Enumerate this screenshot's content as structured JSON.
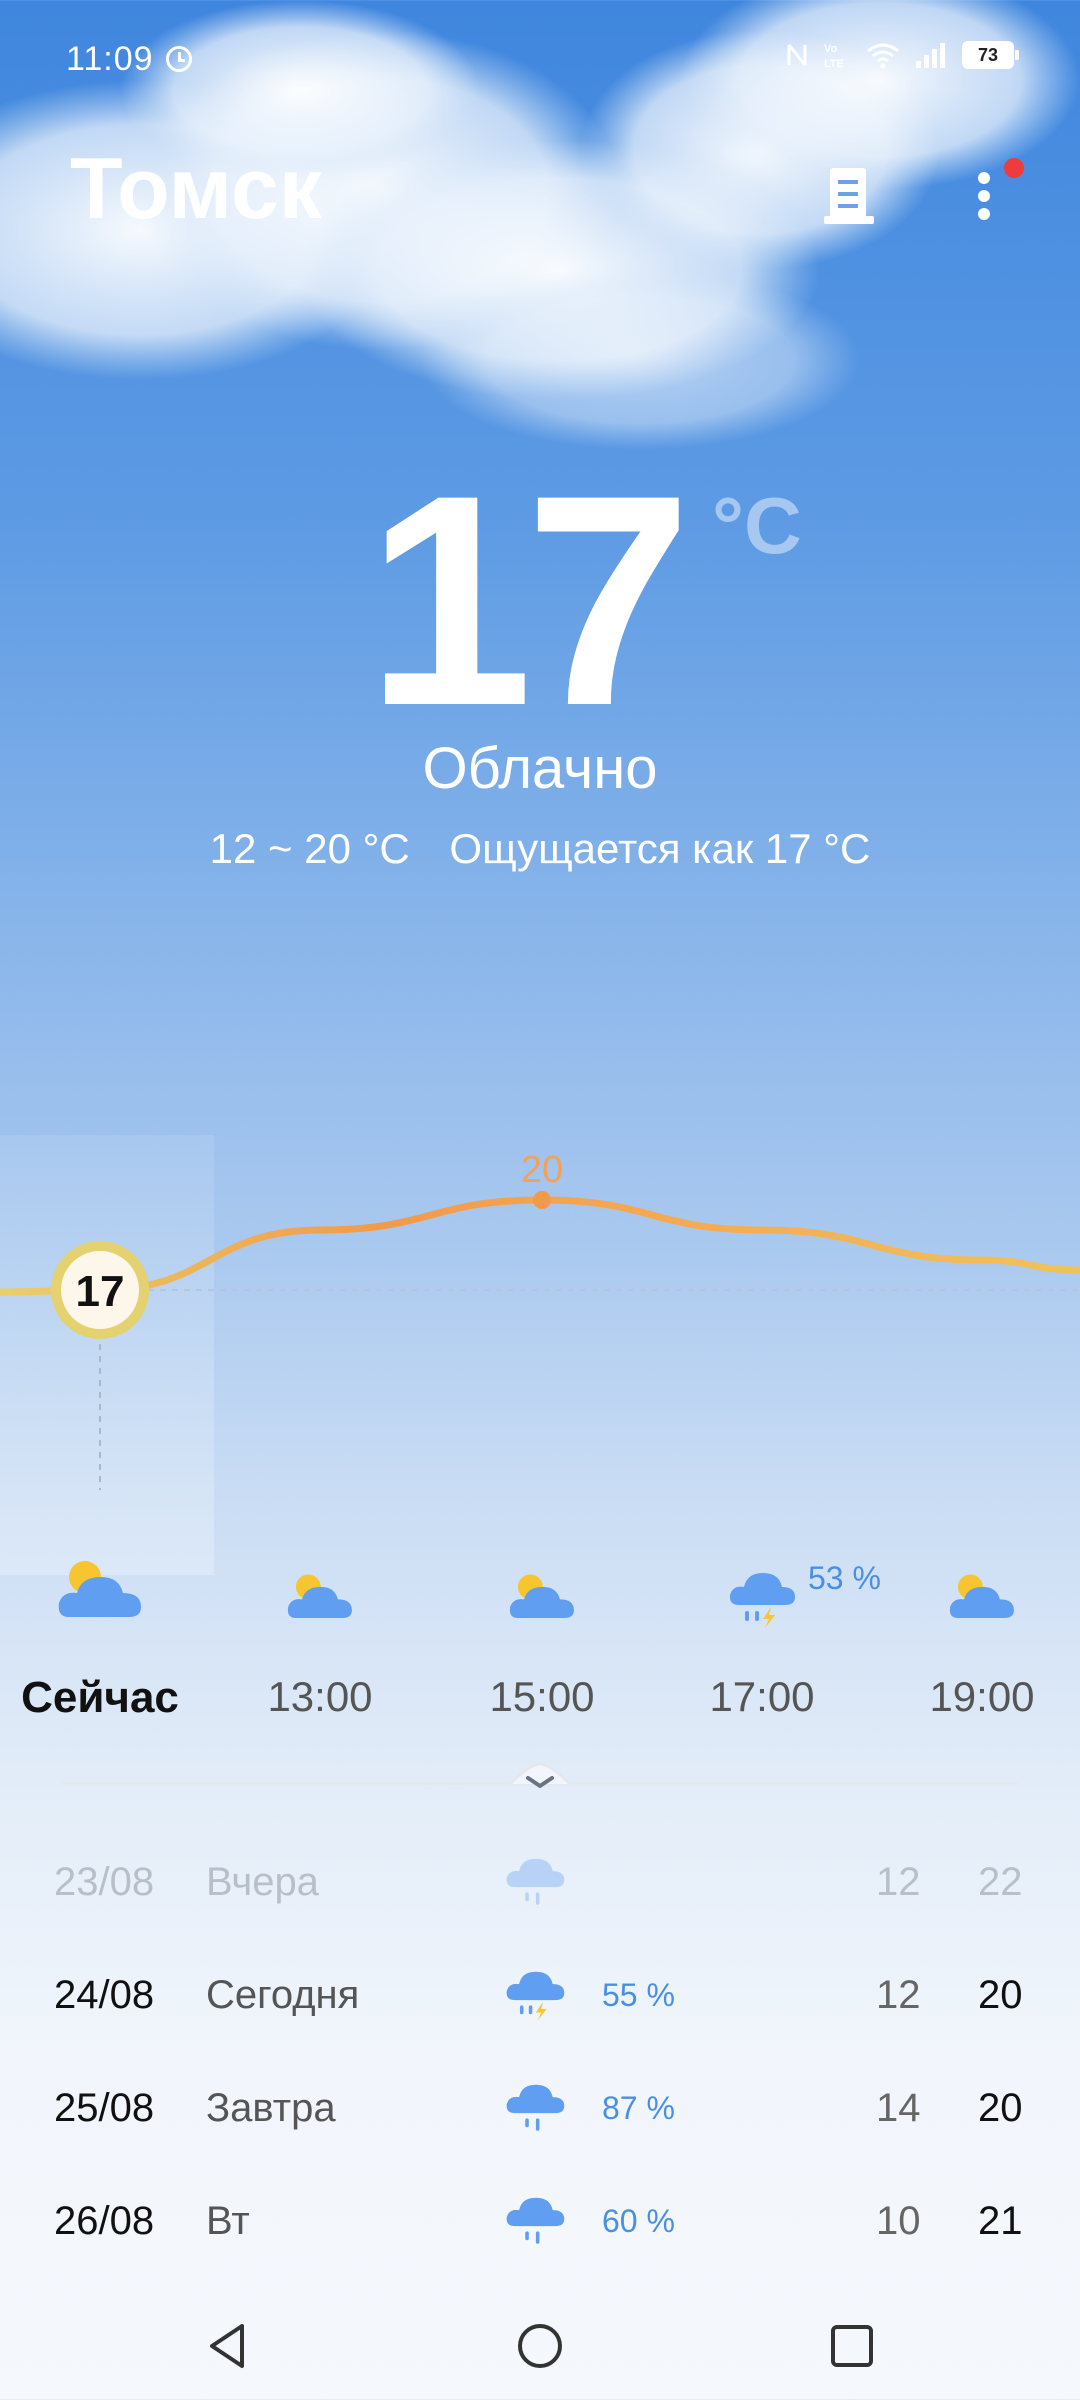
{
  "status_bar": {
    "time": "11:09",
    "battery": "73",
    "icons": [
      "alarm-clock-icon",
      "nfc-icon",
      "volte-icon",
      "wifi-icon",
      "signal-icon",
      "battery-icon"
    ]
  },
  "header": {
    "city": "Томск",
    "icons": [
      "building-icon",
      "more-vert-icon"
    ],
    "badge_color": "#ee3b3b"
  },
  "current": {
    "temp": "17",
    "unit": "°C",
    "condition": "Облачно",
    "range": "12 ~ 20 °C",
    "feels_like": "Ощущается как 17 °C"
  },
  "chart_data": {
    "type": "line",
    "x": [
      "Сейчас",
      "13:00",
      "15:00",
      "17:00",
      "19:00"
    ],
    "series": [
      {
        "values": [
          17,
          19,
          20,
          19,
          18
        ]
      }
    ],
    "labels_shown": {
      "Сейчас": "17",
      "15:00": "20"
    },
    "colors": {
      "line_start": "#e9cf6a",
      "line_mid": "#f29a4a",
      "line_end": "#f0c25a"
    }
  },
  "hourly": [
    {
      "label": "Сейчас",
      "icon": "partly-cloudy-icon",
      "precip": ""
    },
    {
      "label": "13:00",
      "icon": "partly-cloudy-icon",
      "precip": ""
    },
    {
      "label": "15:00",
      "icon": "partly-cloudy-icon",
      "precip": ""
    },
    {
      "label": "17:00",
      "icon": "thunderstorm-icon",
      "precip": "53 %"
    },
    {
      "label": "19:00",
      "icon": "partly-cloudy-icon",
      "precip": ""
    }
  ],
  "daily": [
    {
      "date": "23/08",
      "name": "Вчера",
      "icon": "rain-icon",
      "pct": "",
      "low": "12",
      "high": "22"
    },
    {
      "date": "24/08",
      "name": "Сегодня",
      "icon": "thunderstorm-icon",
      "pct": "55 %",
      "low": "12",
      "high": "20"
    },
    {
      "date": "25/08",
      "name": "Завтра",
      "icon": "rain-icon",
      "pct": "87 %",
      "low": "14",
      "high": "20"
    },
    {
      "date": "26/08",
      "name": "Вт",
      "icon": "rain-icon",
      "pct": "60 %",
      "low": "10",
      "high": "21"
    }
  ],
  "colors": {
    "sky_top": "#3f86de",
    "sun": "#f7c530",
    "cloud_blue": "#5f9ef0",
    "precip_text": "#4a90e2"
  }
}
